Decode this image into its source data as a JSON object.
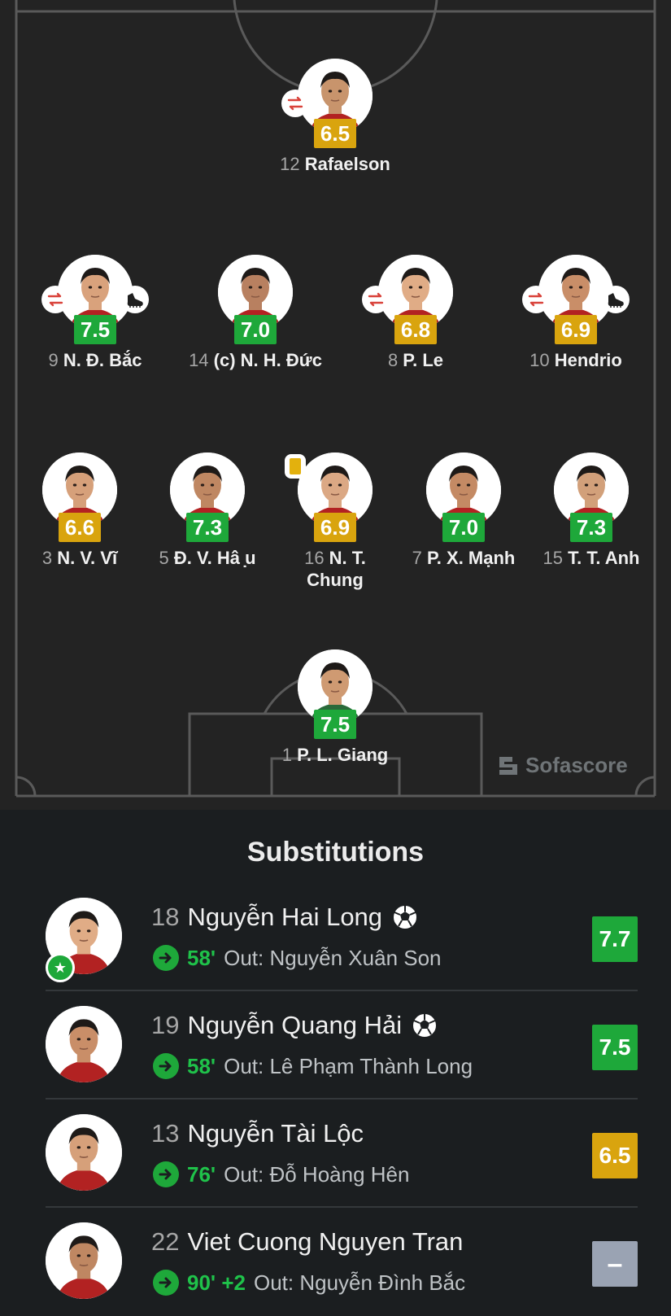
{
  "lineup": {
    "forwards": [
      {
        "number": "12",
        "name": "Rafaelson",
        "rating": "6.5",
        "rating_color": "yellow",
        "badges": [
          "substitution-icon"
        ]
      }
    ],
    "midfield": [
      {
        "number": "9",
        "name": "N. Đ. Bắc",
        "rating": "7.5",
        "rating_color": "green",
        "badges": [
          "substitution-icon",
          "assist-boot-icon"
        ]
      },
      {
        "number": "14",
        "name": "(c) N. H. Đức",
        "rating": "7.0",
        "rating_color": "green",
        "badges": []
      },
      {
        "number": "8",
        "name": "P. Le",
        "rating": "6.8",
        "rating_color": "yellow",
        "badges": [
          "substitution-icon"
        ]
      },
      {
        "number": "10",
        "name": "Hendrio",
        "rating": "6.9",
        "rating_color": "yellow",
        "badges": [
          "substitution-icon",
          "assist-boot-icon"
        ]
      }
    ],
    "defense": [
      {
        "number": "3",
        "name": "N. V. Vĩ",
        "rating": "6.6",
        "rating_color": "yellow",
        "badges": []
      },
      {
        "number": "5",
        "name": "Đ. V. Hâ ̣u",
        "rating": "7.3",
        "rating_color": "green",
        "badges": []
      },
      {
        "number": "16",
        "name": "N. T.",
        "name_line2": "Chung",
        "rating": "6.9",
        "rating_color": "yellow",
        "badges": [
          "yellow-card-icon"
        ]
      },
      {
        "number": "7",
        "name": "P. X. Mạnh",
        "rating": "7.0",
        "rating_color": "green",
        "badges": []
      },
      {
        "number": "15",
        "name": "T. T. Anh",
        "rating": "7.3",
        "rating_color": "green",
        "badges": []
      }
    ],
    "goalkeeper": [
      {
        "number": "1",
        "name": "P. L. Giang",
        "rating": "7.5",
        "rating_color": "green",
        "badges": []
      }
    ]
  },
  "watermark": {
    "text": "Sofascore",
    "icon": "sofascore-logo-icon"
  },
  "substitutions": {
    "title": "Substitutions",
    "items": [
      {
        "number": "18",
        "name": "Nguyễn Hai Long",
        "goal": true,
        "potm": true,
        "minute": "58'",
        "out_label": "Out: Nguyễn Xuân Son",
        "rating": "7.7",
        "rating_color": "green"
      },
      {
        "number": "19",
        "name": "Nguyễn Quang Hải",
        "goal": true,
        "potm": false,
        "minute": "58'",
        "out_label": "Out: Lê Phạm Thành Long",
        "rating": "7.5",
        "rating_color": "green"
      },
      {
        "number": "13",
        "name": "Nguyễn Tài Lộc",
        "goal": false,
        "potm": false,
        "minute": "76'",
        "out_label": "Out: Đỗ Hoàng Hên",
        "rating": "6.5",
        "rating_color": "yellow"
      },
      {
        "number": "22",
        "name": "Viet Cuong Nguyen Tran",
        "goal": false,
        "potm": false,
        "minute": "90' +2",
        "out_label": "Out: Nguyễn Đình Bắc",
        "rating": "–",
        "rating_color": "none"
      }
    ]
  },
  "colors": {
    "pitch": "#232323",
    "background": "#1b1e20",
    "rating_green": "#1ea83a",
    "rating_yellow": "#d9a40e",
    "accent_green": "#1fc24a"
  }
}
